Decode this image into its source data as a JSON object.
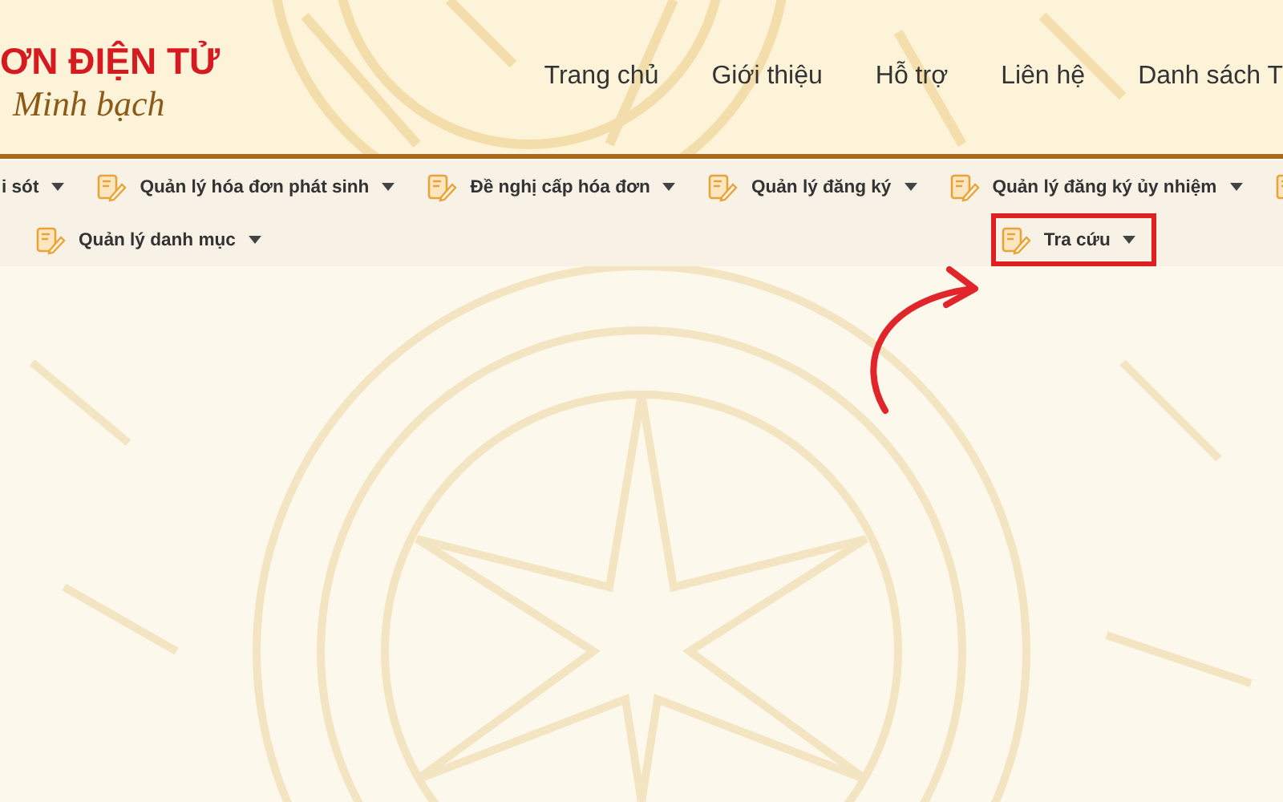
{
  "header": {
    "logo_title": "ƠN ĐIỆN TỬ",
    "logo_slogan": "Minh bạch",
    "nav": [
      "Trang chủ",
      "Giới thiệu",
      "Hỗ trợ",
      "Liên hệ",
      "Danh sách T"
    ]
  },
  "menu": {
    "top_row": [
      {
        "kind": "cut",
        "label": "i sót",
        "highlighted": false
      },
      {
        "kind": "item",
        "label": "Quản lý hóa đơn phát sinh",
        "highlighted": false
      },
      {
        "kind": "item",
        "label": "Đề nghị cấp hóa đơn",
        "highlighted": false
      },
      {
        "kind": "item",
        "label": "Quản lý đăng ký",
        "highlighted": false
      },
      {
        "kind": "item",
        "label": "Quản lý đăng ký ủy nhiệm",
        "highlighted": false
      },
      {
        "kind": "icon",
        "highlighted": false
      }
    ],
    "bottom_row": [
      {
        "kind": "item",
        "label": "Quản lý danh mục",
        "highlighted": false
      },
      {
        "kind": "item",
        "label": "Tra cứu",
        "highlighted": true
      }
    ]
  }
}
